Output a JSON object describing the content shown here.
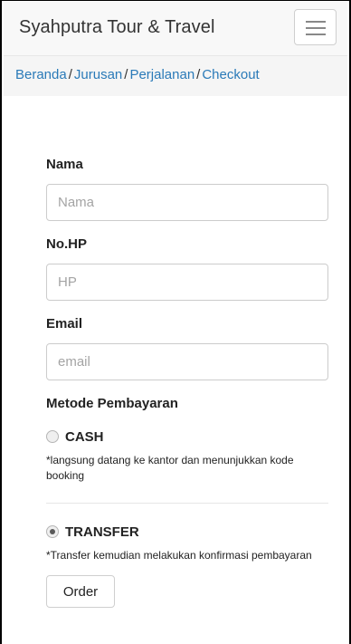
{
  "navbar": {
    "brand": "Syahputra Tour & Travel",
    "menu_icon": "hamburger-menu-icon"
  },
  "breadcrumb": {
    "items": [
      "Beranda",
      "Jurusan",
      "Perjalanan",
      "Checkout"
    ],
    "separator": "/"
  },
  "form": {
    "nama_label": "Nama",
    "nama_placeholder": "Nama",
    "hp_label": "No.HP",
    "hp_placeholder": "HP",
    "email_label": "Email",
    "email_placeholder": "email",
    "payment_label": "Metode Pembayaran",
    "cash": {
      "label": "CASH",
      "checked": false,
      "note": "*langsung datang ke kantor dan menunjukkan kode booking"
    },
    "transfer": {
      "label": "TRANSFER",
      "checked": true,
      "note": "*Transfer kemudian melakukan konfirmasi pembayaran"
    },
    "submit_label": "Order"
  },
  "colors": {
    "link": "#2a7ab8",
    "navbar_bg": "#f8f8f8",
    "breadcrumb_bg": "#f5f5f5"
  }
}
